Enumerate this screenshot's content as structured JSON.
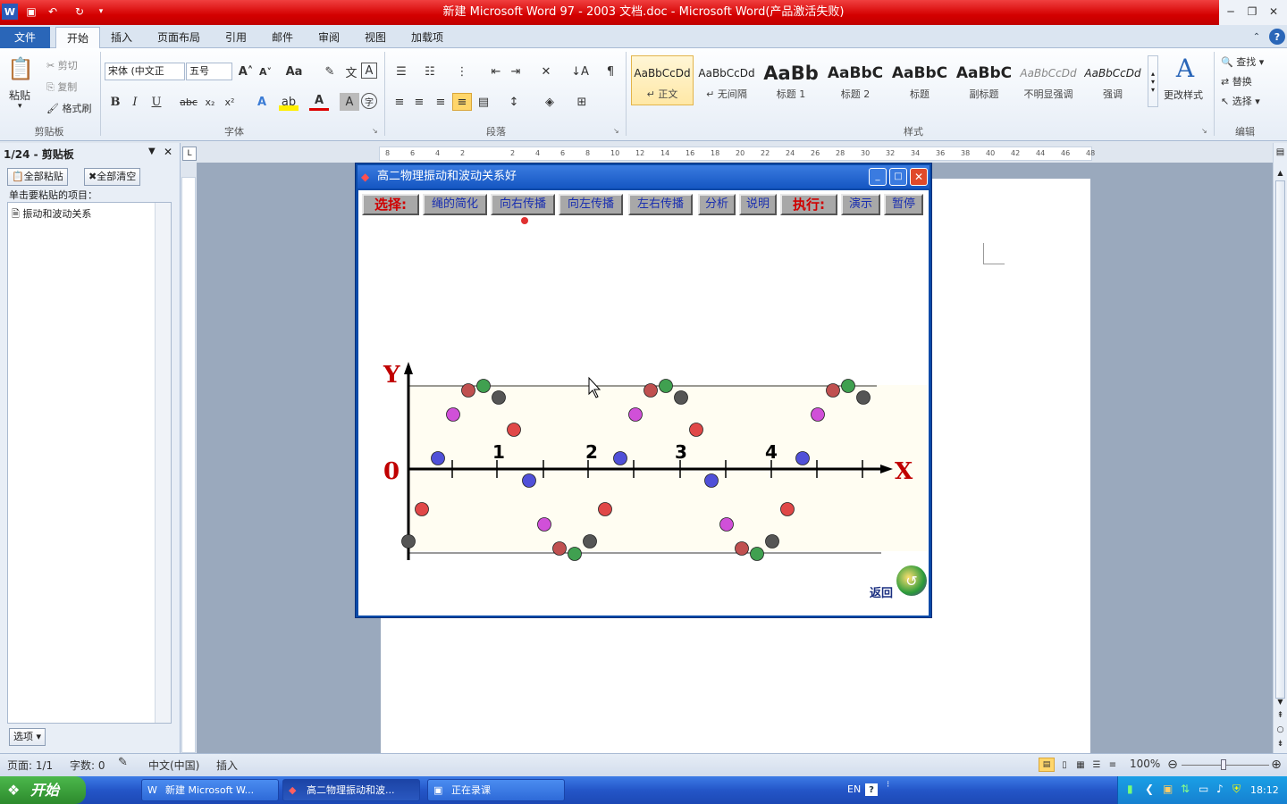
{
  "window": {
    "title": "新建 Microsoft Word 97 - 2003 文档.doc  -  Microsoft Word(产品激活失败)"
  },
  "ribbon": {
    "tabs": [
      "文件",
      "开始",
      "插入",
      "页面布局",
      "引用",
      "邮件",
      "审阅",
      "视图",
      "加载项"
    ],
    "clipboard": {
      "paste": "粘贴",
      "cut": "剪切",
      "copy": "复制",
      "format_painter": "格式刷",
      "label": "剪贴板"
    },
    "font": {
      "name": "宋体 (中文正",
      "size": "五号",
      "label": "字体"
    },
    "paragraph": {
      "label": "段落"
    },
    "styles": {
      "items": [
        {
          "sample": "AaBbCcDd",
          "name": "↵ 正文"
        },
        {
          "sample": "AaBbCcDd",
          "name": "↵ 无间隔"
        },
        {
          "sample": "AaBb",
          "name": "标题 1"
        },
        {
          "sample": "AaBbC",
          "name": "标题 2"
        },
        {
          "sample": "AaBbC",
          "name": "标题"
        },
        {
          "sample": "AaBbC",
          "name": "副标题"
        },
        {
          "sample": "AaBbCcDd",
          "name": "不明显强调"
        },
        {
          "sample": "AaBbCcDd",
          "name": "强调"
        }
      ],
      "change": "更改样式",
      "label": "样式"
    },
    "editing": {
      "find": "查找",
      "replace": "替换",
      "select": "选择",
      "label": "编辑"
    }
  },
  "pane": {
    "title": "1/24 - 剪贴板",
    "paste_all": "全部粘贴",
    "clear_all": "全部清空",
    "hint": "单击要粘贴的项目：",
    "item": "振动和波动关系",
    "options": "选项"
  },
  "ruler": {
    "h_ticks": [
      "8",
      "6",
      "4",
      "2",
      "",
      "2",
      "4",
      "6",
      "8",
      "10",
      "12",
      "14",
      "16",
      "18",
      "20",
      "22",
      "24",
      "26",
      "28",
      "30",
      "32",
      "34",
      "36",
      "38",
      "40",
      "42",
      "44",
      "46",
      "48"
    ]
  },
  "flash": {
    "title": "高二物理振动和波动关系好",
    "select_label": "选择:",
    "exec_label": "执行:",
    "buttons": [
      "绳的简化",
      "向右传播",
      "向左传播",
      "左右传播",
      "分析",
      "说明"
    ],
    "exec_buttons": [
      "演示",
      "暂停"
    ],
    "back": "返回",
    "graph": {
      "y": "Y",
      "x": "X",
      "origin": "0",
      "marks": [
        "1",
        "2",
        "3",
        "4"
      ]
    }
  },
  "status": {
    "page": "页面: 1/1",
    "words": "字数: 0",
    "lang": "中文(中国)",
    "mode": "插入",
    "zoom": "100%"
  },
  "taskbar": {
    "start": "开始",
    "items": [
      "新建 Microsoft W...",
      "高二物理振动和波...",
      "正在录课"
    ],
    "lang": "EN",
    "time": "18:12"
  },
  "colors": {
    "title_red": "#d40000",
    "ribbon_blue": "#2a66b8",
    "taskbar_blue": "#2456c8"
  }
}
